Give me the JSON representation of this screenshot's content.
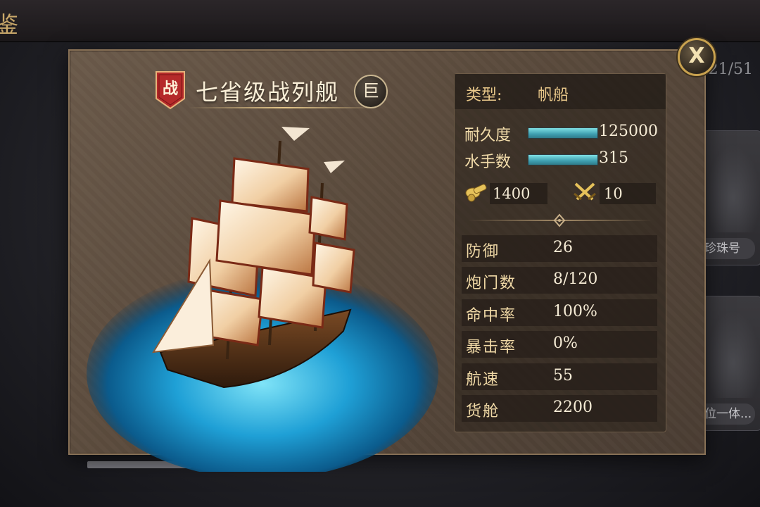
{
  "header": {
    "title_fragment": "鉴",
    "collection_counter": "21/51"
  },
  "background_cards": [
    {
      "label": ""
    },
    {
      "label": ""
    },
    {
      "label": ""
    },
    {
      "label": "珍珠号"
    },
    {
      "label": "位一体..."
    }
  ],
  "dialog": {
    "close_label": "X",
    "role_badge": "战",
    "ship_name": "七省级战列舰",
    "size_badge": "巨",
    "type_label": "类型:",
    "type_value": "帆船",
    "durability": {
      "label": "耐久度",
      "value": "125000",
      "fill": 1.0
    },
    "crew": {
      "label": "水手数",
      "value": "315",
      "fill": 1.0
    },
    "cannon_power": "1400",
    "melee_power": "10",
    "attributes": [
      {
        "label": "防御",
        "value": "26"
      },
      {
        "label": "炮门数",
        "value": "8/120"
      },
      {
        "label": "命中率",
        "value": "100%"
      },
      {
        "label": "暴击率",
        "value": "0%"
      },
      {
        "label": "航速",
        "value": "55"
      },
      {
        "label": "货舱",
        "value": "2200"
      }
    ]
  },
  "colors": {
    "accent_gold": "#e9c88a",
    "bar_teal": "#5fc3cc",
    "badge_red": "#b52a2a"
  }
}
